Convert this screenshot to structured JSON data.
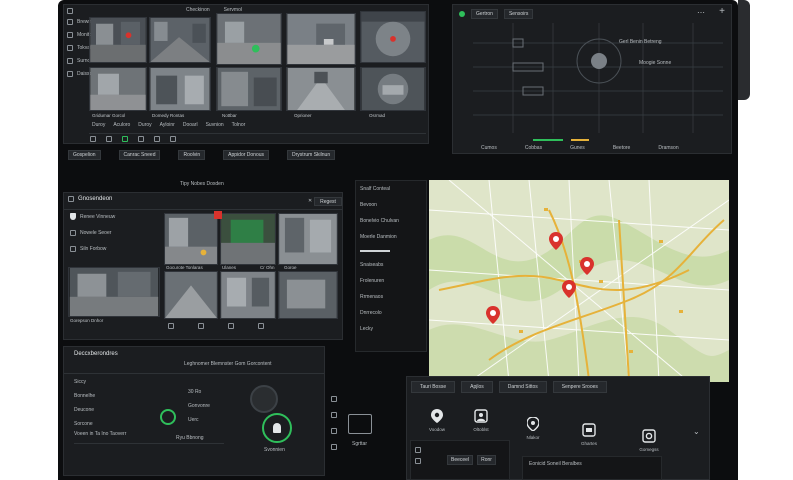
{
  "colors": {
    "accent": "#2fbf5b",
    "pin": "#d9322c",
    "route": "#e6b23a",
    "map_bg": "#dfe5c9"
  },
  "top_panel": {
    "header_labels": [
      "Checkinon",
      "Servmol"
    ],
    "side_labels": [
      "Brewne",
      "Moniton",
      "Tokvan",
      "Surnot",
      "Daisson"
    ],
    "captions": [
      "Gridumar Gorcol",
      "Domedy Rontas",
      "Nottbar",
      "Oprioner",
      "Osrmad"
    ],
    "controls": [
      "Duroy",
      "Aculoro",
      "Duroy",
      "Ayloinr",
      "Dooarl",
      "Suvnion",
      "Tolnor"
    ],
    "filters": [
      "Gospelion",
      "Canrac Sneed",
      "Roolvin",
      "Appidor Donous",
      "Drystrum Skilnun"
    ],
    "mid_title": "Tipy Nobes Doxden"
  },
  "sensor_panel": {
    "tabs": [
      "Gertron",
      "Sensoirs"
    ],
    "readout_1": "Gerl Benin Betreng",
    "readout_2": "Moogie Sonne",
    "scale": [
      "Cumos",
      "Cobbas",
      "Gunes",
      "Beetore",
      "Dramson"
    ]
  },
  "camera_panel": {
    "title": "Gnosendeon",
    "dropdown": "Regest",
    "side_items": [
      "Renee Vinneuw",
      "Nowele Seoer",
      "Siln Forbow"
    ],
    "captions": [
      "Gocurote Tonlaras",
      "Ulanes",
      "Cr Ohn",
      "Goroe",
      "Gorepson Dnhor"
    ]
  },
  "event_panel": {
    "items": [
      "Snalf Conteal",
      "Bevoon",
      "Bonelvio Chulvan",
      "Moerle Danmion",
      "Snaiseabs",
      "Frolenuren",
      "Rrmenaos",
      "Dnrrecolo",
      "Lecky"
    ]
  },
  "bottom_left": {
    "title": "Deccxberondres",
    "subtitle": "Leghnomer Blemnster Gom Gorcontent",
    "list": [
      "Siccy",
      "Bonnelhe",
      "Deucone",
      "Sorcone"
    ],
    "footer": "Voeen in Ta Ino Taoverr",
    "buttons": [
      "Ryu Bbnong"
    ],
    "metrics": [
      "30 Ro",
      "Gonvonre",
      "Uerc"
    ],
    "status": "Svonnien"
  },
  "tool_rail": {
    "label": "Sgrttar"
  },
  "bottom_right": {
    "tabs": [
      "Tauri Bosse",
      "Apjlos",
      "Damnd Sittos",
      "Senpere Srooes"
    ],
    "icons": [
      {
        "name": "location-icon",
        "label": "Voodow"
      },
      {
        "name": "user-icon",
        "label": "Oltoblst"
      },
      {
        "name": "pin-icon",
        "label": "Nlakor"
      },
      {
        "name": "camera-icon",
        "label": "Ghartes"
      },
      {
        "name": "settings-icon",
        "label": "Gomegss"
      }
    ],
    "sub_tabs": [
      "Beeceel",
      "Ronr"
    ],
    "sub_title": "Eonicid Soneil Beralbes"
  }
}
